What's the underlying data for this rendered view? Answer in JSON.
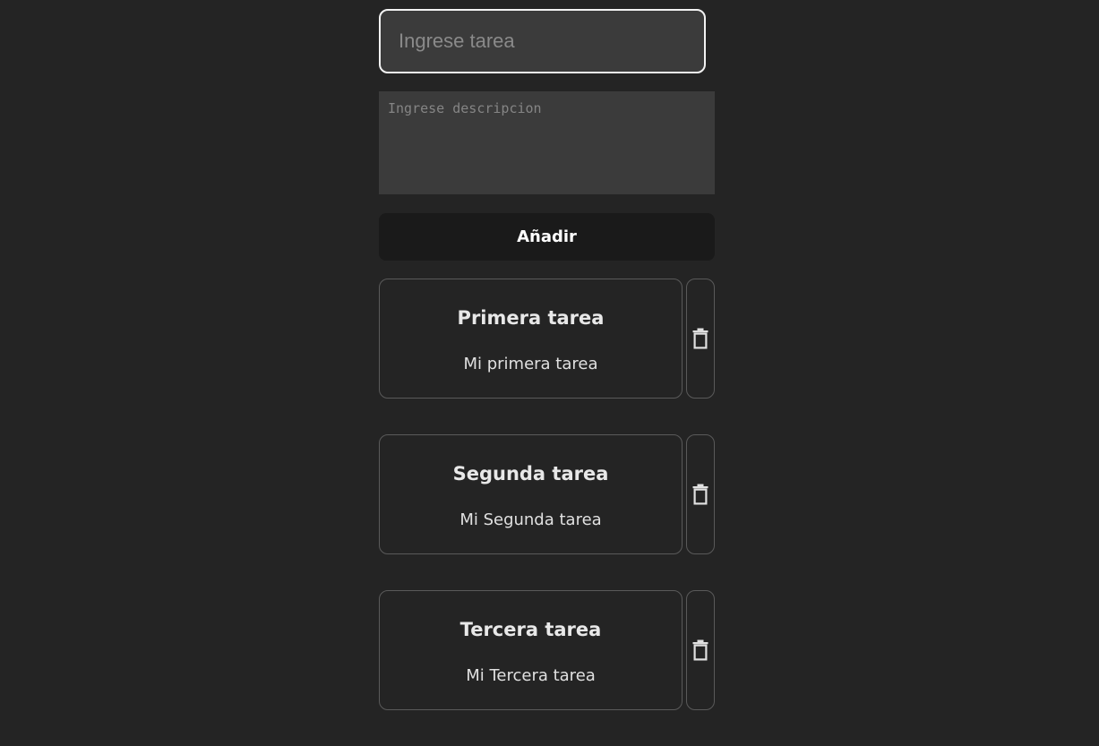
{
  "form": {
    "title_placeholder": "Ingrese tarea",
    "description_placeholder": "Ingrese descripcion",
    "add_label": "Añadir"
  },
  "tasks": [
    {
      "title": "Primera tarea",
      "description": "Mi primera tarea",
      "delete_icon": "trash-icon"
    },
    {
      "title": "Segunda tarea",
      "description": "Mi Segunda tarea",
      "delete_icon": "trash-icon"
    },
    {
      "title": "Tercera tarea",
      "description": "Mi Tercera tarea",
      "delete_icon": "trash-icon"
    }
  ],
  "colors": {
    "background": "#242424",
    "input_background": "#3b3b3b",
    "button_background": "#1a1a1a",
    "border": "#5a5a5a",
    "focus_border": "#f2f2f2"
  }
}
